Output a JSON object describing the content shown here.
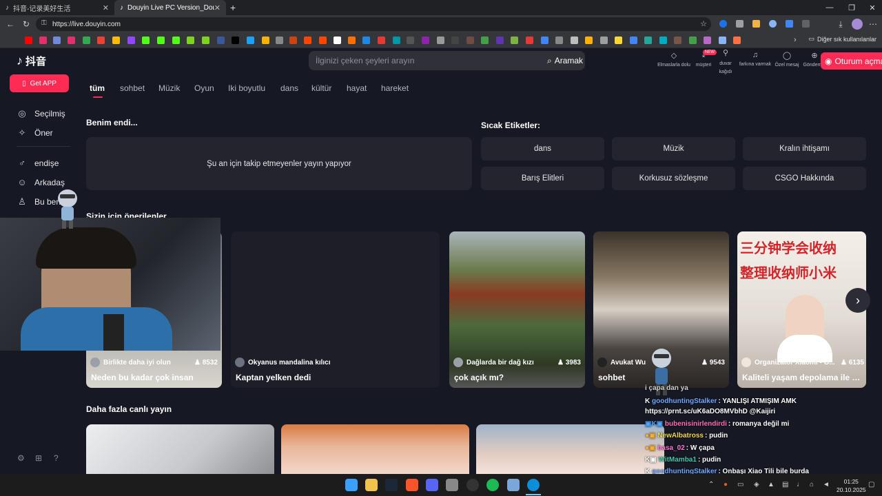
{
  "browser": {
    "tabs": [
      {
        "title": "抖音-记录美好生活",
        "active": false
      },
      {
        "title": "Douyin Live PC Version_Douyin L",
        "active": true
      }
    ],
    "new_tab": "+",
    "window_controls": {
      "minimize": "—",
      "maximize": "❐",
      "close": "✕"
    },
    "url": "https://live.douyin.com",
    "other_bookmarks": "Diğer sık kullanılanlar"
  },
  "douyin": {
    "logo_text": "抖音",
    "get_app": "Get APP",
    "sidebar": [
      {
        "icon": "selected-icon",
        "glyph": "◎",
        "label": "Seçilmiş"
      },
      {
        "icon": "recommend-icon",
        "glyph": "✧",
        "label": "Öner"
      },
      {
        "icon": "follow-icon",
        "glyph": "♂",
        "label": "endişe"
      },
      {
        "icon": "friends-icon",
        "glyph": "☺",
        "label": "Arkadaş"
      },
      {
        "icon": "me-icon",
        "glyph": "♙",
        "label": "Bu ben"
      }
    ],
    "search": {
      "placeholder": "İlginizi çeken şeyleri arayın",
      "button": "Aramak"
    },
    "header_actions": [
      {
        "icon": "diamond-icon",
        "glyph": "◇",
        "label": "Elmaslarla dolu"
      },
      {
        "icon": "download-icon",
        "glyph": "⤓",
        "label": "müşteri"
      },
      {
        "icon": "wallpaper-icon",
        "glyph": "⚲",
        "label": "duvar kağıdı"
      },
      {
        "icon": "bell-icon",
        "glyph": "♫",
        "label": "farkına varmak"
      },
      {
        "icon": "message-icon",
        "glyph": "◯",
        "label": "Özel mesaj"
      },
      {
        "icon": "upload-icon",
        "glyph": "⊕",
        "label": "Gönderme"
      }
    ],
    "new_badge": "NEW",
    "login": "Oturum açma",
    "categories": [
      "tüm",
      "sohbet",
      "Müzik",
      "Oyun",
      "Iki boyutlu",
      "dans",
      "kültür",
      "hayat",
      "hareket"
    ],
    "following_title": "Benim endi...",
    "following_empty": "Şu an için takip etmeyenler yayın yapıyor",
    "hot_tags_title": "Sıcak Etiketler:",
    "hot_tags": [
      "dans",
      "Müzik",
      "Kralın ihtişamı",
      "Barış Elitleri",
      "Korkusuz sözleşme",
      "CSGO Hakkında"
    ],
    "recommended_title": "Sizin için önerilenler",
    "cards": [
      {
        "author": "Birlikte daha iyi olun",
        "viewers": "8532",
        "title": "Neden bu kadar çok insan",
        "color": "#b9b7b1"
      },
      {
        "author": "Okyanus mandalina kılıcı",
        "viewers": "",
        "title": "Kaptan yelken dedi",
        "color": "#1d1e27"
      },
      {
        "author": "Dağlarda bir dağ kızı",
        "viewers": "3983",
        "title": "çok açık mı?",
        "color": "#4e6a3c"
      },
      {
        "author": "Avukat Wu",
        "viewers": "9543",
        "title": "sohbet",
        "color": "#6b5b49"
      },
      {
        "author": "Organizatör Xiaomi - G...",
        "viewers": "6135",
        "title": "Kaliteli yaşam depolama ile ba...",
        "color": "#e3ddd6"
      }
    ],
    "card5_overlay_line1": "三分钟学会收纳",
    "card5_overlay_line2": "整理收纳师小米",
    "more_live_title": "Daha fazla canlı yayın",
    "more_cards": [
      {
        "color": "#d8d9dc"
      },
      {
        "color": "#d58b58"
      },
      {
        "color": "#c7d3e0"
      }
    ],
    "footer_icons": [
      "settings-icon",
      "apps-icon",
      "help-icon"
    ]
  },
  "chat": [
    {
      "user": "goodhuntingStalker",
      "msg": ": YANLIŞI ATMIŞIM AMK",
      "color": "#6fa8ff"
    },
    {
      "user": "",
      "msg": "https://prnt.sc/uK6aDO8MVbhD @Kaijiri",
      "color": "#ffffff"
    },
    {
      "user": "bubenisinirlendirdi",
      "msg": ": romanya değil mi",
      "color": "#ff6fb5"
    },
    {
      "user": "NewAlbatross",
      "msg": ": pudin",
      "color": "#f2d94e"
    },
    {
      "user": "basa_02",
      "msg": ": W çapa",
      "color": "#ff77d1"
    },
    {
      "user": "WitMamba1",
      "msg": ": pudin",
      "color": "#44c7a6"
    },
    {
      "user": "goodhuntingStalker",
      "msg": ": Onbaşı Xiao Tili bile burda",
      "color": "#6fa8ff"
    }
  ],
  "chat_partial_top": "i çapa dan ya",
  "taskbar": {
    "time": "01:25",
    "date": "20.10.2025"
  }
}
